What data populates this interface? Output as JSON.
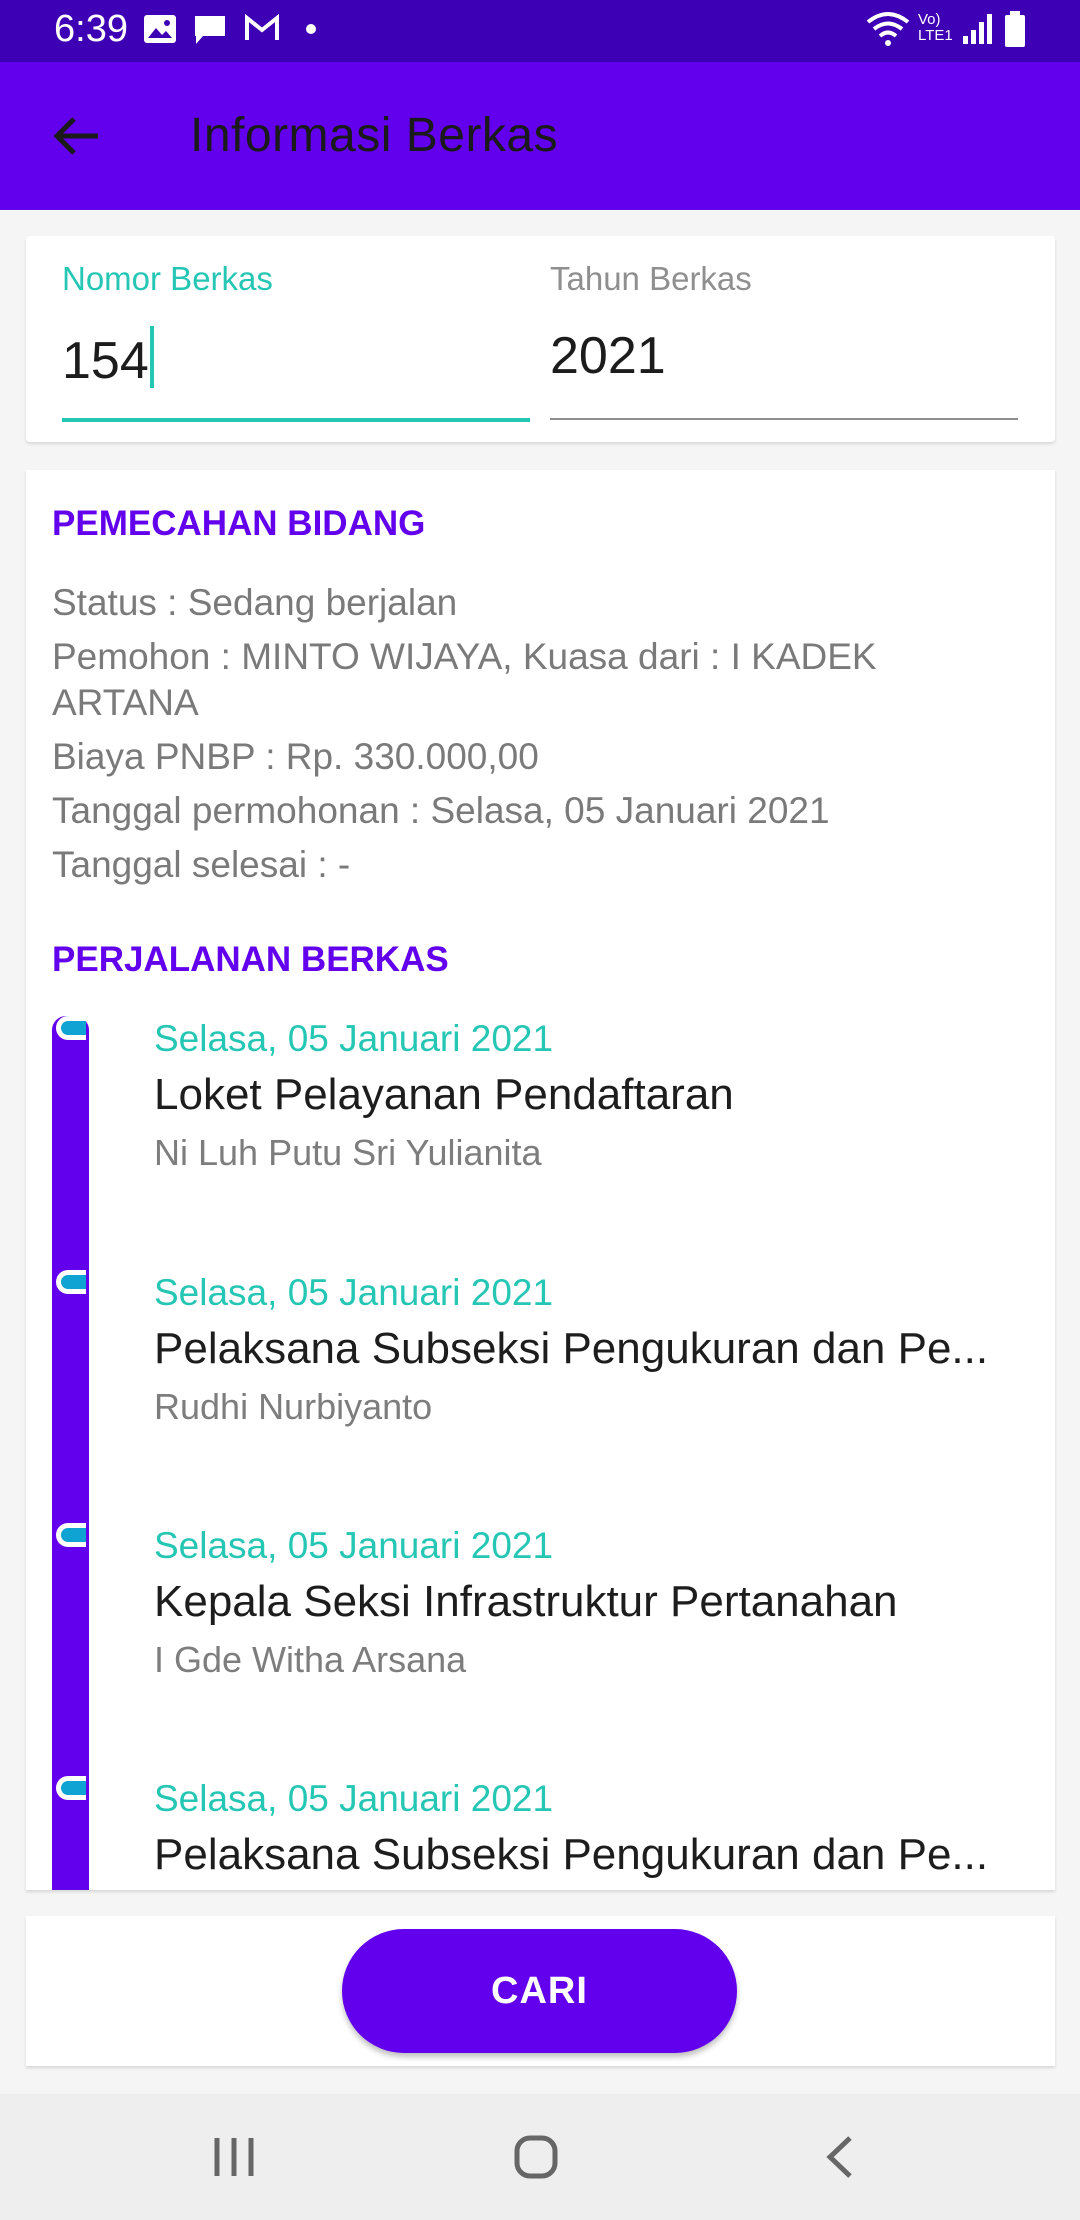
{
  "status_bar": {
    "time": "6:39",
    "network_label": "Vo) LTE1"
  },
  "app_bar": {
    "title": "Informasi Berkas",
    "back_icon": "arrow-left-icon"
  },
  "form": {
    "nomor_label": "Nomor Berkas",
    "nomor_value": "154",
    "tahun_label": "Tahun Berkas",
    "tahun_value": "2021"
  },
  "info": {
    "section_title": "PEMECAHAN BIDANG",
    "status": "Status : Sedang berjalan",
    "pemohon": "Pemohon : MINTO WIJAYA,  Kuasa dari : I KADEK ARTANA",
    "biaya": "Biaya PNBP : Rp. 330.000,00",
    "tanggal_permohonan": "Tanggal permohonan : Selasa, 05 Januari 2021",
    "tanggal_selesai": "Tanggal selesai : -"
  },
  "timeline": {
    "section_title": "PERJALANAN BERKAS",
    "items": [
      {
        "date": "Selasa, 05 Januari 2021",
        "title": "Loket Pelayanan Pendaftaran",
        "name": "Ni Luh Putu Sri Yulianita"
      },
      {
        "date": "Selasa, 05 Januari 2021",
        "title": "Pelaksana Subseksi Pengukuran dan Pe...",
        "name": "Rudhi Nurbiyanto"
      },
      {
        "date": "Selasa, 05 Januari 2021",
        "title": "Kepala Seksi Infrastruktur Pertanahan",
        "name": "I Gde Witha Arsana"
      },
      {
        "date": "Selasa, 05 Januari 2021",
        "title": "Pelaksana Subseksi Pengukuran dan Pe...",
        "name": ""
      }
    ]
  },
  "actions": {
    "search_label": "CARI"
  },
  "colors": {
    "primary": "#6200ee",
    "status_bar": "#3d00b5",
    "accent": "#26c6b5",
    "dot": "#0fa3d3"
  }
}
